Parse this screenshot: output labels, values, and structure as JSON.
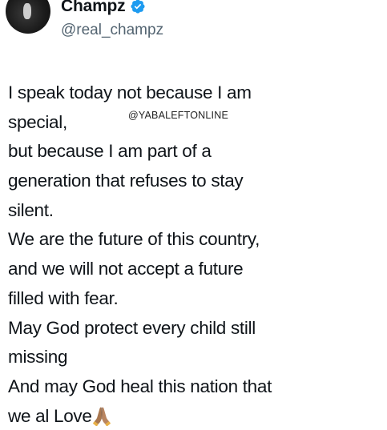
{
  "author": {
    "display_name": "Champz",
    "handle": "@real_champz",
    "verified_icon": "verified-badge-icon",
    "badge_color": "#1d9bf0"
  },
  "tweet": {
    "lines": [
      "I speak today not because I am",
      "special,",
      "but because I am part of a",
      "generation that refuses to stay",
      "silent.",
      "We are the future of this country,",
      "and we will not accept a future",
      "filled with fear.",
      "May God protect every child still",
      "missing",
      "And may God heal this nation that",
      "we al Love"
    ],
    "trailing_emoji": "folded-hands-icon"
  },
  "watermark": {
    "text": "@YABALEFTONLINE"
  }
}
